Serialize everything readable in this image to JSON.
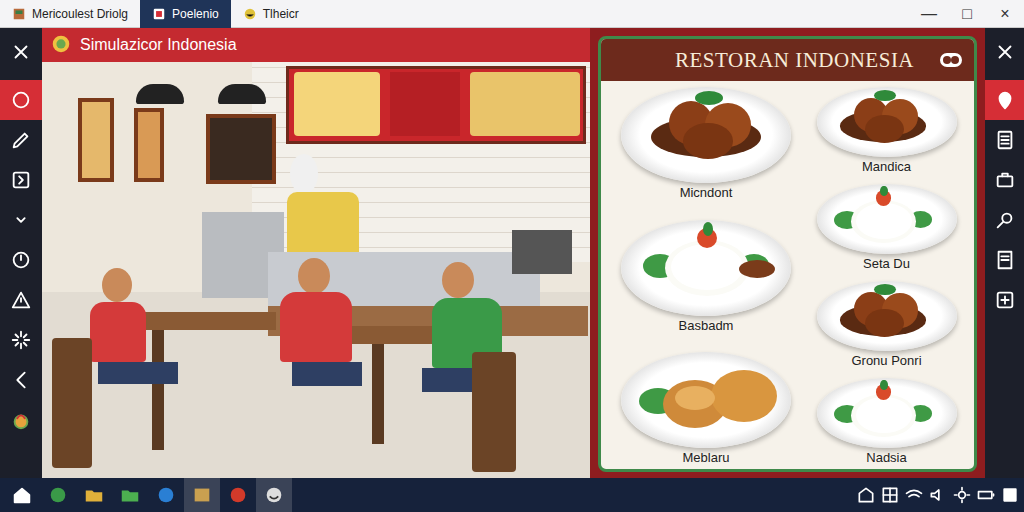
{
  "window": {
    "tabs": [
      {
        "label": "Mericoulest Driolg",
        "selected": false
      },
      {
        "label": "Poelenio",
        "selected": true
      },
      {
        "label": "Tlheicr",
        "selected": false
      }
    ],
    "controls": [
      "—",
      "□",
      "×"
    ]
  },
  "left_toolbar": [
    {
      "selected": false
    },
    {
      "selected": true
    },
    {
      "selected": false
    },
    {
      "selected": false
    },
    {
      "selected": false
    },
    {
      "selected": false
    },
    {
      "selected": false
    },
    {
      "selected": false
    },
    {
      "selected": false
    },
    {
      "selected": false
    }
  ],
  "right_toolbar": [
    {
      "selected": false
    },
    {
      "selected": true
    },
    {
      "selected": false
    },
    {
      "selected": false
    },
    {
      "selected": false
    },
    {
      "selected": false
    },
    {
      "selected": false
    }
  ],
  "left_panel": {
    "title": "Simulazicor Indonesia"
  },
  "menu": {
    "title": "RESTORAN INDONESIA",
    "left_column": [
      {
        "name": "Micndont",
        "kind": "chicken"
      },
      {
        "name": "Basbadm",
        "kind": "rice"
      },
      {
        "name": "Meblaru",
        "kind": "bread"
      }
    ],
    "right_column": [
      {
        "name": "Mandica",
        "kind": "chicken"
      },
      {
        "name": "Seta Du",
        "kind": "rice"
      },
      {
        "name": "Gronu Ponri",
        "kind": "chicken"
      },
      {
        "name": "Nadsia",
        "kind": "rice"
      }
    ]
  },
  "taskbar": [
    {
      "selected": false
    },
    {
      "selected": false
    },
    {
      "selected": false
    },
    {
      "selected": false
    },
    {
      "selected": false
    },
    {
      "selected": true
    },
    {
      "selected": false
    },
    {
      "selected": true
    }
  ]
}
